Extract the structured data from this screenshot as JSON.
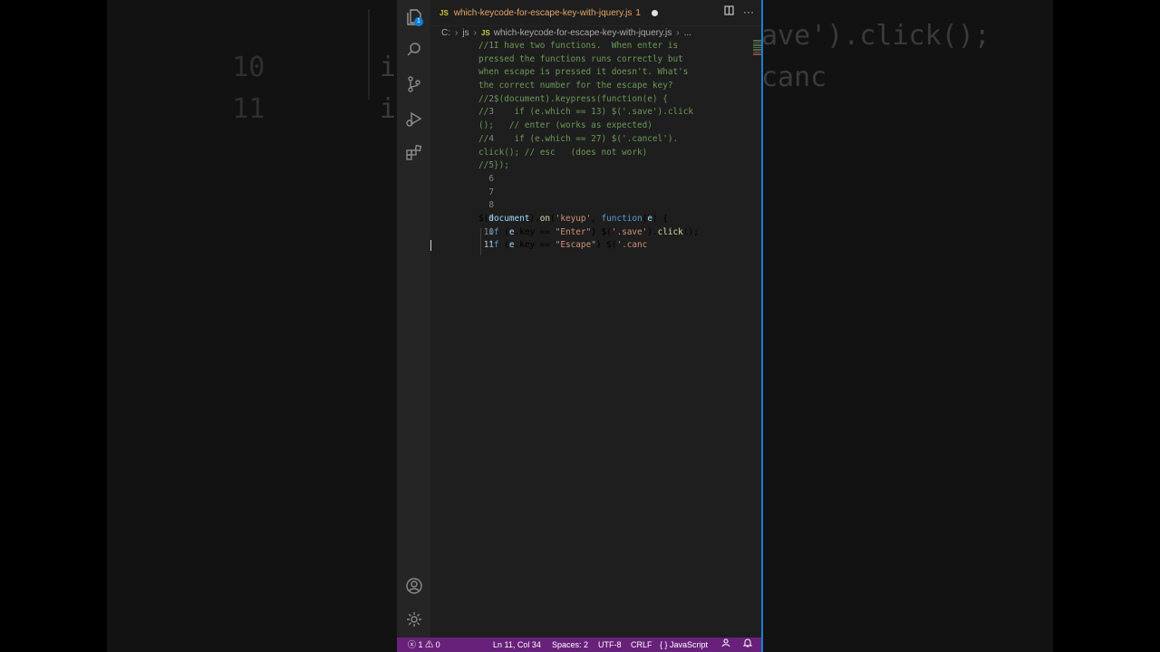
{
  "background": {
    "lines": [
      {
        "num": "10",
        "code": "if (e.",
        "right": "ave').click();"
      },
      {
        "num": "11",
        "code": "if (e.",
        "right": "canc"
      }
    ]
  },
  "tab": {
    "lang_badge": "JS",
    "title": "which-keycode-for-escape-key-with-jquery.js",
    "problems": "1"
  },
  "breadcrumb": {
    "drive": "C:",
    "folder": "js",
    "lang_badge": "JS",
    "file": "which-keycode-for-escape-key-with-jquery.js",
    "more": "..."
  },
  "activity": {
    "explorer_badge": "1"
  },
  "code_lines": [
    {
      "num": "1",
      "text": "// I have two functions.  When enter is"
    },
    {
      "num": "",
      "text": "pressed the functions runs correctly but"
    },
    {
      "num": "",
      "text": "when escape is pressed it doesn't. What's"
    },
    {
      "num": "",
      "text": "the correct number for the escape key?"
    },
    {
      "num": "2",
      "text": "// $(document).keypress(function(e) {"
    },
    {
      "num": "3",
      "text": "//     if (e.which == 13) $('.save').click"
    },
    {
      "num": "",
      "text": "();   // enter (works as expected)"
    },
    {
      "num": "4",
      "text": "//     if (e.which == 27) $('.cancel')."
    },
    {
      "num": "",
      "text": "click(); // esc   (does not work)"
    },
    {
      "num": "5",
      "text": "// });"
    },
    {
      "num": "6",
      "text": ""
    },
    {
      "num": "7",
      "text": ""
    },
    {
      "num": "8",
      "text": ""
    },
    {
      "num": "9",
      "text": "$(document).on('keyup', function(e) {"
    },
    {
      "num": "10",
      "text": "  if (e.key == \"Enter\") $('.save').click();"
    },
    {
      "num": "11",
      "text": "  if (e.key == \"Escape\") $('.canc"
    }
  ],
  "statusbar": {
    "errors": "1",
    "warnings": "0",
    "position": "Ln 11, Col 34",
    "spaces": "Spaces: 2",
    "encoding": "UTF-8",
    "eol": "CRLF",
    "language": "JavaScript",
    "language_braces": "{ }"
  },
  "colors": {
    "statusbar": "#68217a",
    "editor_bg": "#1e1e1e",
    "comment": "#6a9955",
    "string": "#ce9178"
  }
}
